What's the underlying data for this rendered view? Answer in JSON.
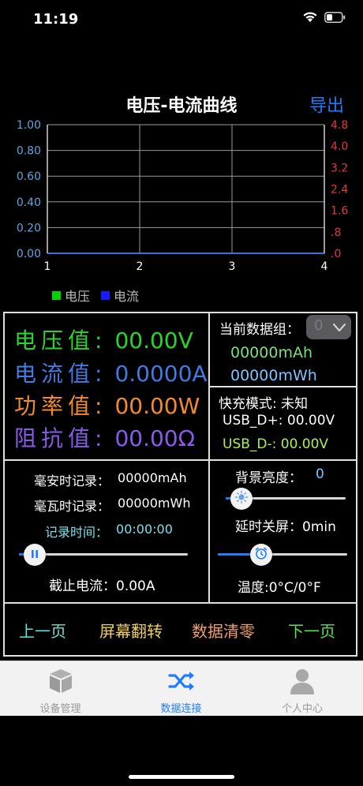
{
  "status_bar": {
    "time": "11:19"
  },
  "header": {
    "title": "电压-电流曲线",
    "export_label": "导出"
  },
  "chart_data": {
    "type": "line",
    "title": "电压-电流曲线",
    "x": [
      1,
      2,
      3,
      4
    ],
    "xlim": [
      1,
      4
    ],
    "x_ticks": [
      "1",
      "2",
      "3",
      "4"
    ],
    "y_left": {
      "ticks": [
        "1.00",
        "0.80",
        "0.60",
        "0.40",
        "0.20",
        "0.00"
      ],
      "ylim": [
        0,
        1
      ],
      "color": "#5aa8e0"
    },
    "y_right": {
      "ticks": [
        "4.8",
        "4.0",
        "3.2",
        "2.4",
        "1.6",
        ".8",
        ".0"
      ],
      "ylim": [
        0,
        4.8
      ],
      "color": "#e03a3a"
    },
    "grid": true,
    "legend_position": "bottom-left",
    "series": [
      {
        "name": "电压",
        "values": [],
        "color": "#00d400"
      },
      {
        "name": "电流",
        "values": [],
        "color": "#1a1aff"
      }
    ]
  },
  "measurements": {
    "voltage": {
      "label": "电压值:",
      "value": "00.00V",
      "color": "#2bd42b"
    },
    "current": {
      "label": "电流值:",
      "value": "0.0000A",
      "color": "#3f7be0"
    },
    "power": {
      "label": "功率值:",
      "value": "00.00W",
      "color": "#f08a2c"
    },
    "impedance": {
      "label": "阻抗值:",
      "value": "00.00Ω",
      "color": "#8a5ae8"
    }
  },
  "data_group": {
    "label": "当前数据组：",
    "selected": "0",
    "mah": "00000mAh",
    "mwh": "00000mWh",
    "mah_color": "#7be07b",
    "mwh_color": "#7cc4ff"
  },
  "quick_charge": {
    "mode_label": "快充模式:",
    "mode_value": "未知",
    "usb_dp_label": "USB_D+:",
    "usb_dp_value": "00.00V",
    "usb_dm_label": "USB_D-:",
    "usb_dm_value": "00.00V"
  },
  "records": {
    "mah_label": "毫安时记录：",
    "mah_value": "00000mAh",
    "mwh_label": "毫瓦时记录：",
    "mwh_value": "00000mWh",
    "time_label": "记录时间：",
    "time_value": "00:00:00",
    "record_slider_fraction": 0.03
  },
  "cutoff_current": {
    "label": "截止电流：",
    "value": "0.00A"
  },
  "background_brightness": {
    "label": "背景亮度：",
    "value": "0",
    "fraction": 0.05
  },
  "delay_off": {
    "label": "延时关屏：",
    "value": "0min",
    "fraction": 0.3
  },
  "temperature": {
    "label": "温度:",
    "value": "0°C/0°F"
  },
  "bottom_buttons": [
    {
      "label": "上一页",
      "color": "#6ee0d8"
    },
    {
      "label": "屏幕翻转",
      "color": "#f0d060"
    },
    {
      "label": "数据清零",
      "color": "#f0a070"
    },
    {
      "label": "下一页",
      "color": "#5ae05a"
    }
  ],
  "tabbar": {
    "active_color": "#1f7cff",
    "inactive_color": "#9a9a9a",
    "tabs": [
      {
        "label": "设备管理",
        "icon": "box-icon"
      },
      {
        "label": "数据连接",
        "icon": "shuffle-icon"
      },
      {
        "label": "个人中心",
        "icon": "person-icon"
      }
    ]
  }
}
